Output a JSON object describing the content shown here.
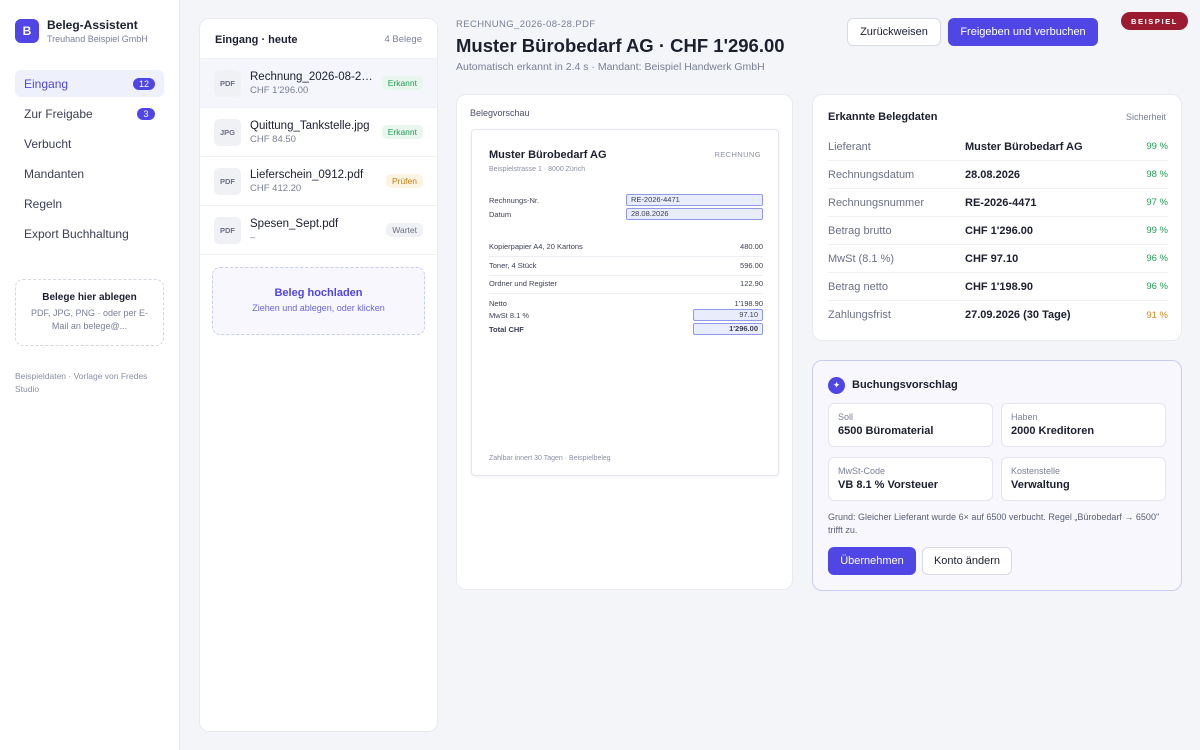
{
  "brand": {
    "logo": "B",
    "name": "Beleg-Assistent",
    "sub": "Treuhand Beispiel GmbH"
  },
  "nav": [
    {
      "label": "Eingang",
      "badge": "12"
    },
    {
      "label": "Zur Freigabe",
      "badge": "3"
    },
    {
      "label": "Verbucht",
      "badge": ""
    },
    {
      "label": "Mandanten",
      "badge": ""
    },
    {
      "label": "Regeln",
      "badge": ""
    },
    {
      "label": "Export Buchhaltung",
      "badge": ""
    }
  ],
  "dropbox": {
    "title": "Belege hier ablegen",
    "sub": "PDF, JPG, PNG · oder per E-Mail an belege@..."
  },
  "footer": "Beispieldaten · Vorlage von Fredes Studio",
  "inbox": {
    "title": "Eingang · heute",
    "count": "4 Belege",
    "docs": [
      {
        "type": "PDF",
        "name": "Rechnung_2026-08-28.pdf",
        "amount": "CHF 1'296.00",
        "status": "Erkannt"
      },
      {
        "type": "JPG",
        "name": "Quittung_Tankstelle.jpg",
        "amount": "CHF 84.50",
        "status": "Erkannt"
      },
      {
        "type": "PDF",
        "name": "Lieferschein_0912.pdf",
        "amount": "CHF 412.20",
        "status": "Prüfen"
      },
      {
        "type": "PDF",
        "name": "Spesen_Sept.pdf",
        "amount": "–",
        "status": "Wartet"
      }
    ],
    "upload_title": "Beleg hochladen",
    "upload_sub": "Ziehen und ablegen, oder klicken"
  },
  "header": {
    "filename": "RECHNUNG_2026-08-28.PDF",
    "title": "Muster Bürobedarf AG · CHF 1'296.00",
    "subtitle": "Automatisch erkannt in 2.4 s · Mandant: Beispiel Handwerk GmbH",
    "reject_label": "Zurückweisen",
    "approve_label": "Freigeben und verbuchen",
    "example_badge": "BEISPIEL"
  },
  "preview": {
    "label": "Belegvorschau",
    "vendor": "Muster Bürobedarf AG",
    "kind": "RECHNUNG",
    "address": "Beispielstrasse 1 · 8000 Zürich",
    "invoice_no_label": "Rechnungs-Nr.",
    "invoice_no": "RE-2026-4471",
    "date_label": "Datum",
    "date": "28.08.2026",
    "items": [
      {
        "desc": "Kopierpapier A4, 20 Kartons",
        "amount": "480.00"
      },
      {
        "desc": "Toner, 4 Stück",
        "amount": "596.00"
      },
      {
        "desc": "Ordner und Register",
        "amount": "122.90"
      }
    ],
    "netto_label": "Netto",
    "netto": "1'198.90",
    "mwst_label": "MwSt 8.1 %",
    "mwst": "97.10",
    "total_label": "Total CHF",
    "total": "1'296.00",
    "footer": "Zahlbar innert 30 Tagen · Beispielbeleg"
  },
  "extracted": {
    "title": "Erkannte Belegdaten",
    "confidence_label": "Sicherheit",
    "rows": [
      {
        "key": "Lieferant",
        "value": "Muster Bürobedarf AG",
        "conf": "99 %"
      },
      {
        "key": "Rechnungsdatum",
        "value": "28.08.2026",
        "conf": "98 %"
      },
      {
        "key": "Rechnungsnummer",
        "value": "RE-2026-4471",
        "conf": "97 %"
      },
      {
        "key": "Betrag brutto",
        "value": "CHF 1'296.00",
        "conf": "99 %"
      },
      {
        "key": "MwSt (8.1 %)",
        "value": "CHF 97.10",
        "conf": "96 %"
      },
      {
        "key": "Betrag netto",
        "value": "CHF 1'198.90",
        "conf": "96 %"
      },
      {
        "key": "Zahlungsfrist",
        "value": "27.09.2026 (30 Tage)",
        "conf": "91 %"
      }
    ]
  },
  "booking": {
    "title": "Buchungsvorschlag",
    "soll_label": "Soll",
    "soll": "6500 Büromaterial",
    "haben_label": "Haben",
    "haben": "2000 Kreditoren",
    "mwst_code_label": "MwSt-Code",
    "mwst_code": "VB 8.1 % Vorsteuer",
    "kst_label": "Kostenstelle",
    "kst": "Verwaltung",
    "reason": "Grund: Gleicher Lieferant wurde 6× auf 6500 verbucht. Regel „Bürobedarf → 6500\" trifft zu.",
    "accept_label": "Übernehmen",
    "change_label": "Konto ändern"
  },
  "colors": {
    "accent": "#4f46e5",
    "ok": "#1f9d55",
    "warn": "#d98a1c",
    "badge": "#9b1c31"
  }
}
